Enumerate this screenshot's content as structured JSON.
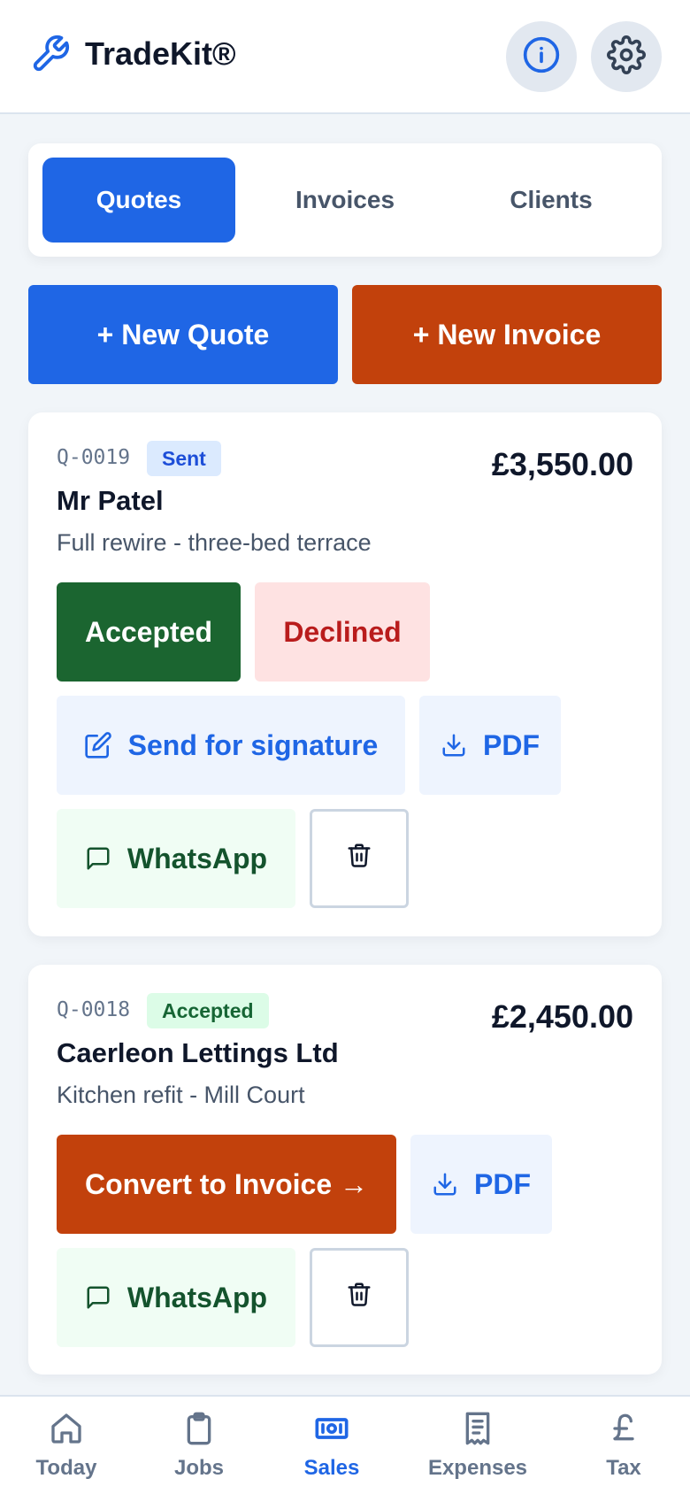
{
  "app": {
    "name": "TradeKit®"
  },
  "header": {
    "info_icon": "info-icon",
    "settings_icon": "gear-icon"
  },
  "tabs": [
    {
      "label": "Quotes",
      "active": true
    },
    {
      "label": "Invoices",
      "active": false
    },
    {
      "label": "Clients",
      "active": false
    }
  ],
  "actions": {
    "new_quote": "+ New Quote",
    "new_invoice": "+ New Invoice"
  },
  "quotes": [
    {
      "number": "Q-0019",
      "status": "Sent",
      "amount": "£3,550.00",
      "client": "Mr Patel",
      "description": "Full rewire - three-bed terrace",
      "buttons": {
        "accepted": "Accepted",
        "declined": "Declined",
        "signature": "Send for signature",
        "pdf": "PDF",
        "whatsapp": "WhatsApp"
      }
    },
    {
      "number": "Q-0018",
      "status": "Accepted",
      "amount": "£2,450.00",
      "client": "Caerleon Lettings Ltd",
      "description": "Kitchen refit - Mill Court",
      "buttons": {
        "convert": "Convert to Invoice →",
        "pdf": "PDF",
        "whatsapp": "WhatsApp"
      }
    }
  ],
  "nav": [
    {
      "label": "Today",
      "icon": "home-icon",
      "active": false
    },
    {
      "label": "Jobs",
      "icon": "clipboard-icon",
      "active": false
    },
    {
      "label": "Sales",
      "icon": "banknote-icon",
      "active": true
    },
    {
      "label": "Expenses",
      "icon": "receipt-icon",
      "active": false
    },
    {
      "label": "Tax",
      "icon": "pound-icon",
      "active": false
    }
  ],
  "colors": {
    "primary": "#1f66e5",
    "accent": "#c2410c",
    "success": "#1b6530",
    "danger": "#b91c1c"
  }
}
